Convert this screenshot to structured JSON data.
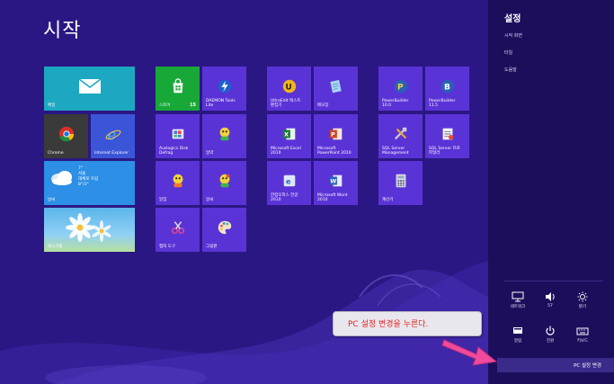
{
  "start": {
    "title": "시작"
  },
  "tiles": {
    "mail": "메일",
    "chrome": "Chrome",
    "ie": "Internet Explorer",
    "weather": {
      "label": "날씨",
      "text": "7°\n서울\n대체로 흐림\n8°/3°"
    },
    "photos": "데스크톱",
    "store": {
      "label": "스토어",
      "badge": "15"
    },
    "daemon": "DAEMON Tools\nLite",
    "auslogics": "Auslogics Disk\nDefrag",
    "t_ab": "알약",
    "t_al": "알집",
    "t_as": "알씨",
    "paint_tool": "캡처 도구",
    "paint": "그림판",
    "ultraedit": "UltraEdit 텍스트\n편집기",
    "notepad": "메모장",
    "excel": "Microsoft Excel\n2010",
    "ppt": "Microsoft\nPowerPoint 2010",
    "hangul": "한컴오피스 한글\n2010",
    "word": "Microsoft Word\n2010",
    "pb10": "PowerBuilder\n10.0",
    "pb115": "PowerBuilder\n11.5",
    "sqlmgmt": "SQL Server\nManagement",
    "sqlprof": "SQL Server 프로\n파일러",
    "calc": "계산기"
  },
  "charms": {
    "title": "설정",
    "items": [
      "시작 화면",
      "타일",
      "도움말"
    ],
    "quick": {
      "network": "네트워크",
      "volume": "57",
      "brightness": "밝기",
      "notifications": "알림",
      "power": "전원",
      "keyboard": "키보드"
    },
    "pc_settings": "PC 설정 변경"
  },
  "callout": {
    "text": "PC 설정 변경을 누른다."
  },
  "colors": {
    "start_bg": "#2b1783",
    "charms_bg": "#1d0e5c",
    "tile_purple": "#5a33d6",
    "accent": "#e0261f"
  }
}
